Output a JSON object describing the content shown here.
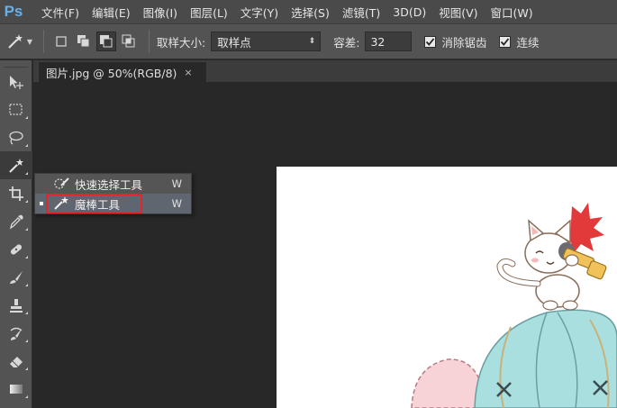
{
  "app": {
    "logo": "Ps"
  },
  "menu": [
    "文件(F)",
    "编辑(E)",
    "图像(I)",
    "图层(L)",
    "文字(Y)",
    "选择(S)",
    "滤镜(T)",
    "3D(D)",
    "视图(V)",
    "窗口(W)"
  ],
  "options": {
    "sample_size_label": "取样大小:",
    "sample_size_value": "取样点",
    "tolerance_label": "容差:",
    "tolerance_value": "32",
    "antialias_label": "消除锯齿",
    "antialias_checked": true,
    "contiguous_label": "连续",
    "contiguous_checked": true
  },
  "document": {
    "tab_title": "图片.jpg @ 50%(RGB/8)",
    "tab_close": "×"
  },
  "flyout": {
    "items": [
      {
        "label": "快速选择工具",
        "shortcut": "W",
        "icon": "quick-selection-icon",
        "selected": false
      },
      {
        "label": "魔棒工具",
        "shortcut": "W",
        "icon": "magic-wand-icon",
        "selected": true
      }
    ]
  },
  "toolbar": {
    "tools": [
      "move-icon",
      "marquee-icon",
      "lasso-icon",
      "magic-wand-icon",
      "crop-icon",
      "eyedropper-icon",
      "healing-brush-icon",
      "brush-icon",
      "clone-stamp-icon",
      "history-brush-icon",
      "eraser-icon",
      "gradient-icon"
    ]
  },
  "colors": {
    "menubar": "#4a4a4a",
    "panel": "#535353",
    "workspace": "#282828",
    "highlight_border": "#e8232b",
    "logo": "#6ab0e8"
  }
}
